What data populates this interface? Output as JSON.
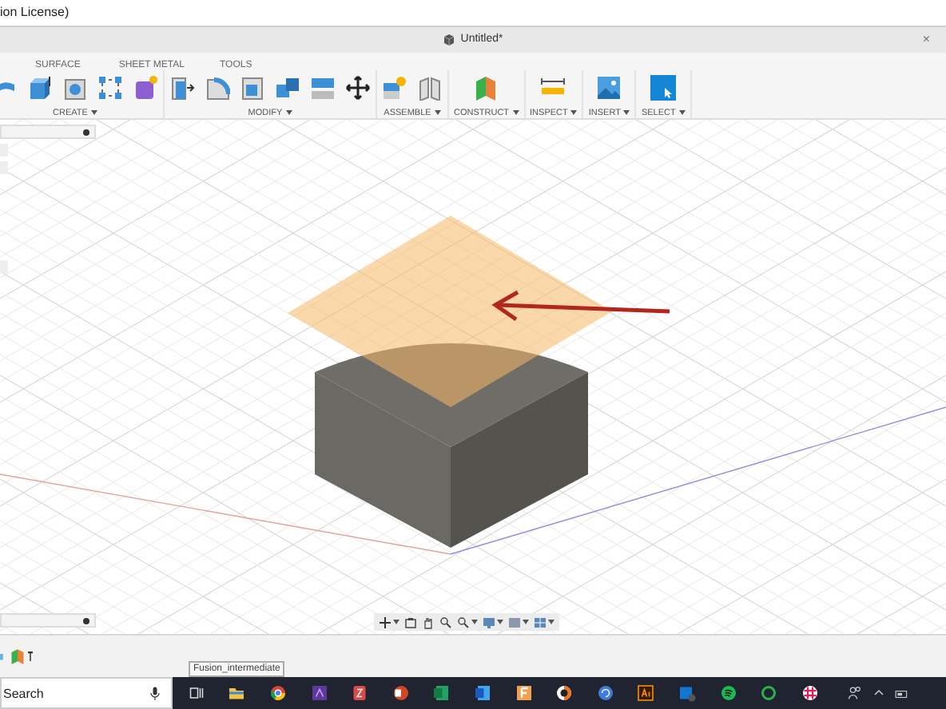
{
  "title_bar": {
    "title": "ion License)"
  },
  "document_tab": {
    "title": "Untitled*",
    "close": "×"
  },
  "toolbar": {
    "tabs": [
      {
        "label": "SURFACE",
        "selected": false
      },
      {
        "label": "SHEET METAL",
        "selected": false
      },
      {
        "label": "TOOLS",
        "selected": false
      }
    ],
    "groups": [
      {
        "label": "CREATE"
      },
      {
        "label": "MODIFY"
      },
      {
        "label": "ASSEMBLE"
      },
      {
        "label": "CONSTRUCT"
      },
      {
        "label": "INSPECT"
      },
      {
        "label": "INSERT"
      },
      {
        "label": "SELECT"
      }
    ]
  },
  "tooltip": {
    "text": "Fusion_intermediate"
  },
  "taskbar": {
    "search": {
      "placeholder": "Search"
    }
  }
}
